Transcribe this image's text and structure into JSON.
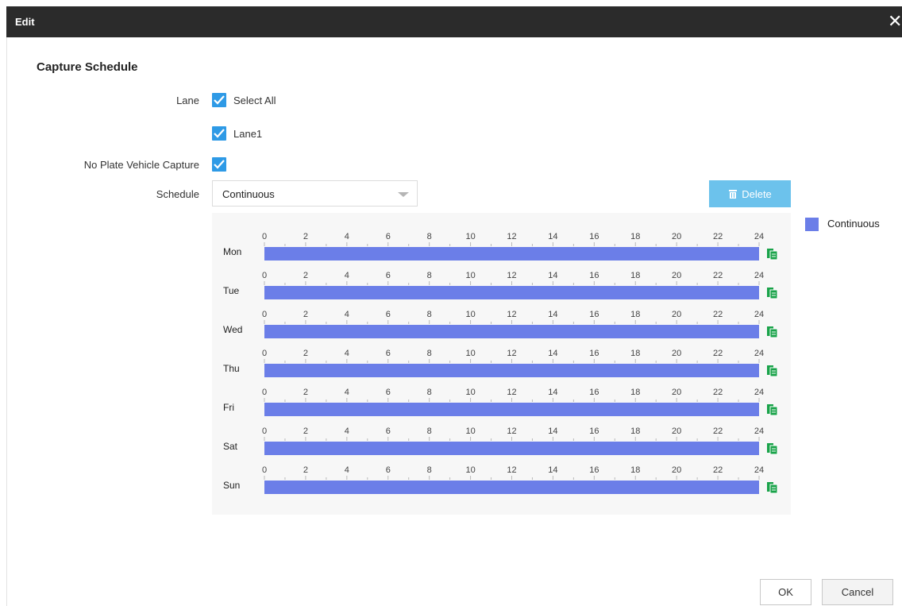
{
  "dialog": {
    "title": "Edit",
    "close_icon": "close-icon"
  },
  "section_title": "Capture Schedule",
  "lane": {
    "label": "Lane",
    "select_all": {
      "label": "Select All",
      "checked": true
    },
    "lanes": [
      {
        "label": "Lane1",
        "checked": true
      }
    ]
  },
  "no_plate": {
    "label": "No Plate Vehicle Capture",
    "checked": true
  },
  "schedule": {
    "label": "Schedule",
    "value": "Continuous"
  },
  "delete_button": {
    "label": "Delete",
    "icon": "trash-icon"
  },
  "legend": {
    "label": "Continuous",
    "color": "#6b7ee8"
  },
  "timeline": {
    "hours": [
      "0",
      "2",
      "4",
      "6",
      "8",
      "10",
      "12",
      "14",
      "16",
      "18",
      "20",
      "22",
      "24"
    ],
    "bar_color": "#6b7ee8",
    "copy_icon": "copy-icon",
    "copy_icon_color": "#1aa34a",
    "days": [
      {
        "label": "Mon",
        "start": 0,
        "end": 24
      },
      {
        "label": "Tue",
        "start": 0,
        "end": 24
      },
      {
        "label": "Wed",
        "start": 0,
        "end": 24
      },
      {
        "label": "Thu",
        "start": 0,
        "end": 24
      },
      {
        "label": "Fri",
        "start": 0,
        "end": 24
      },
      {
        "label": "Sat",
        "start": 0,
        "end": 24
      },
      {
        "label": "Sun",
        "start": 0,
        "end": 24
      }
    ]
  },
  "footer": {
    "ok_label": "OK",
    "cancel_label": "Cancel"
  }
}
